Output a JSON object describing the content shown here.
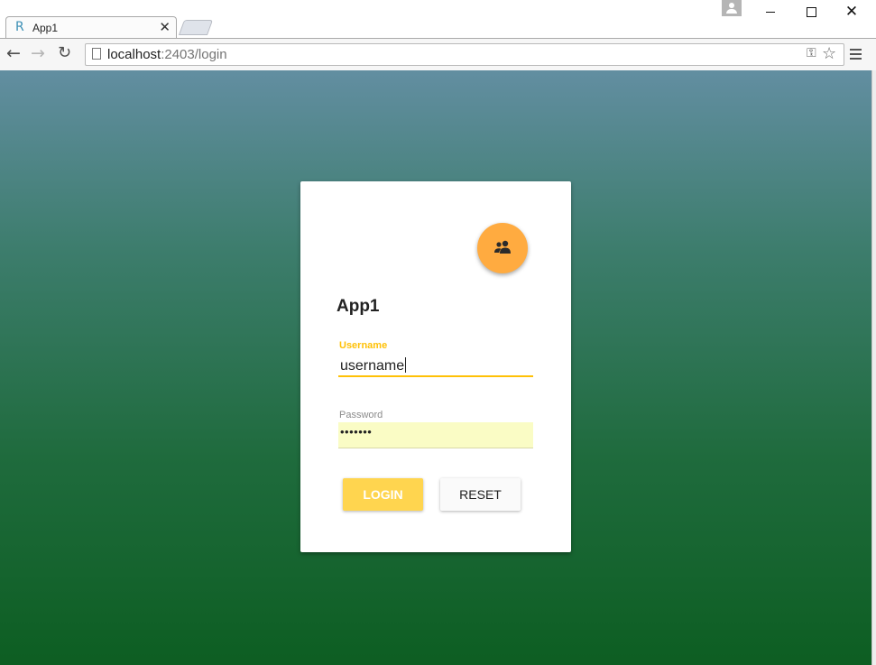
{
  "browser": {
    "tab": {
      "favicon": "R",
      "title": "App1",
      "close_glyph": "✕"
    },
    "window_controls": {
      "close_glyph": "✕"
    },
    "toolbar": {
      "back_glyph": "←",
      "forward_glyph": "→",
      "reload_glyph": "↻"
    },
    "address_bar": {
      "host": "localhost",
      "rest": ":2403/login"
    },
    "icons": [
      "tab-favicon",
      "profile-icon",
      "back-arrow-icon",
      "forward-arrow-icon",
      "reload-icon",
      "page-icon",
      "key-icon",
      "star-icon",
      "menu-icon"
    ]
  },
  "login_card": {
    "avatar_icon": "users-icon",
    "app_title": "App1",
    "username": {
      "label": "Username",
      "value": "username"
    },
    "password": {
      "label": "Password",
      "masked_value": "•••••••"
    },
    "buttons": {
      "login": "LOGIN",
      "reset": "RESET"
    }
  },
  "colors": {
    "accent": "#ffc107",
    "avatar": "#ffab40",
    "login_button": "#ffd54f",
    "autofill_bg": "#fafcc5",
    "bg_top": "#628ea1",
    "bg_bottom": "#0d5e22"
  }
}
